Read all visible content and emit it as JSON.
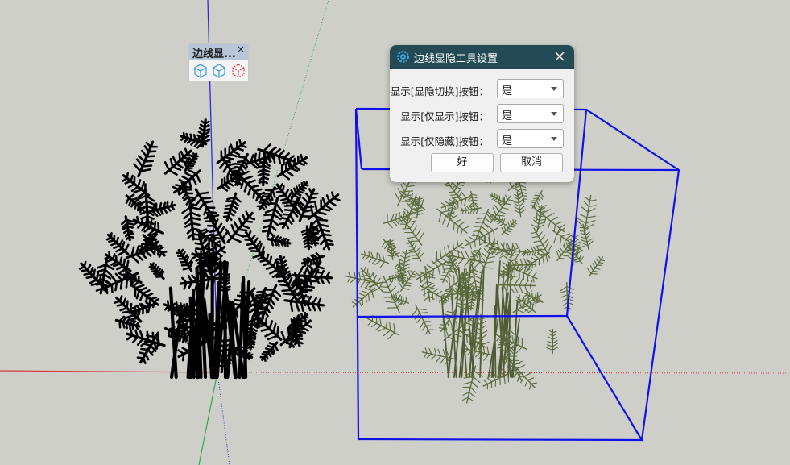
{
  "toolbar": {
    "title": "边线显...",
    "close_label": "×",
    "buttons": [
      {
        "icon": "cube-toggle-icon",
        "color": "#3a9bd5"
      },
      {
        "icon": "cube-show-icon",
        "color": "#3a9bd5"
      },
      {
        "icon": "cube-hide-icon",
        "color": "#e03a3a"
      }
    ]
  },
  "dialog": {
    "title": "边线显隐工具设置",
    "logo_icon": "gear-logo-icon",
    "close_icon": "close-icon",
    "rows": [
      {
        "label": "显示[显隐切换]按钮：",
        "value": "是"
      },
      {
        "label": "显示[仅显示]按钮：",
        "value": "是"
      },
      {
        "label": "显示[仅隐藏]按钮：",
        "value": "是"
      }
    ],
    "ok_label": "好",
    "cancel_label": "取消"
  },
  "viewport": {
    "background": "#cfcfca",
    "axis_colors": {
      "red": "#d33b3b",
      "green": "#2ea84a",
      "blue": "#2b2be0"
    },
    "selection_box_color": "#1010e8",
    "plant_left_color": "#000000",
    "plant_right_color": "#5a6a3c"
  }
}
